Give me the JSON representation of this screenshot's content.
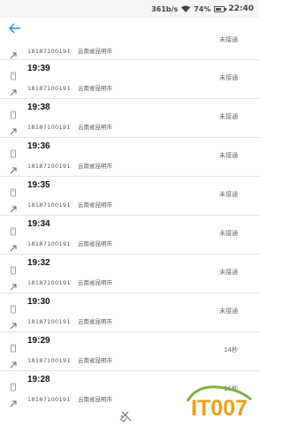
{
  "status_bar": {
    "speed": "361b/s",
    "battery_percent": 74,
    "battery_label": "74%",
    "time": "22:40"
  },
  "header": {
    "back_icon": "back-arrow-icon"
  },
  "calls": [
    {
      "time": "",
      "number": "18187100191",
      "location": "云南省昆明市",
      "status": "未接通"
    },
    {
      "time": "19:39",
      "number": "18187100191",
      "location": "云南省昆明市",
      "status": "未接通"
    },
    {
      "time": "19:38",
      "number": "18187100191",
      "location": "云南省昆明市",
      "status": "未接通"
    },
    {
      "time": "19:36",
      "number": "18187100191",
      "location": "云南省昆明市",
      "status": "未接通"
    },
    {
      "time": "19:35",
      "number": "18187100191",
      "location": "云南省昆明市",
      "status": "未接通"
    },
    {
      "time": "19:34",
      "number": "18187100191",
      "location": "云南省昆明市",
      "status": "未接通"
    },
    {
      "time": "19:32",
      "number": "18187100191",
      "location": "云南省昆明市",
      "status": "未接通"
    },
    {
      "time": "19:30",
      "number": "18187100191",
      "location": "云南省昆明市",
      "status": "未接通"
    },
    {
      "time": "19:29",
      "number": "18187100191",
      "location": "云南省昆明市",
      "status": "14秒"
    },
    {
      "time": "19:28",
      "number": "18187100191",
      "location": "云南省昆明市",
      "status": "16秒"
    }
  ],
  "watermark": {
    "text": "IT007"
  },
  "colors": {
    "accent": "#1e88e5",
    "watermark_orange": "#f39c12",
    "watermark_green": "#7cb342"
  }
}
